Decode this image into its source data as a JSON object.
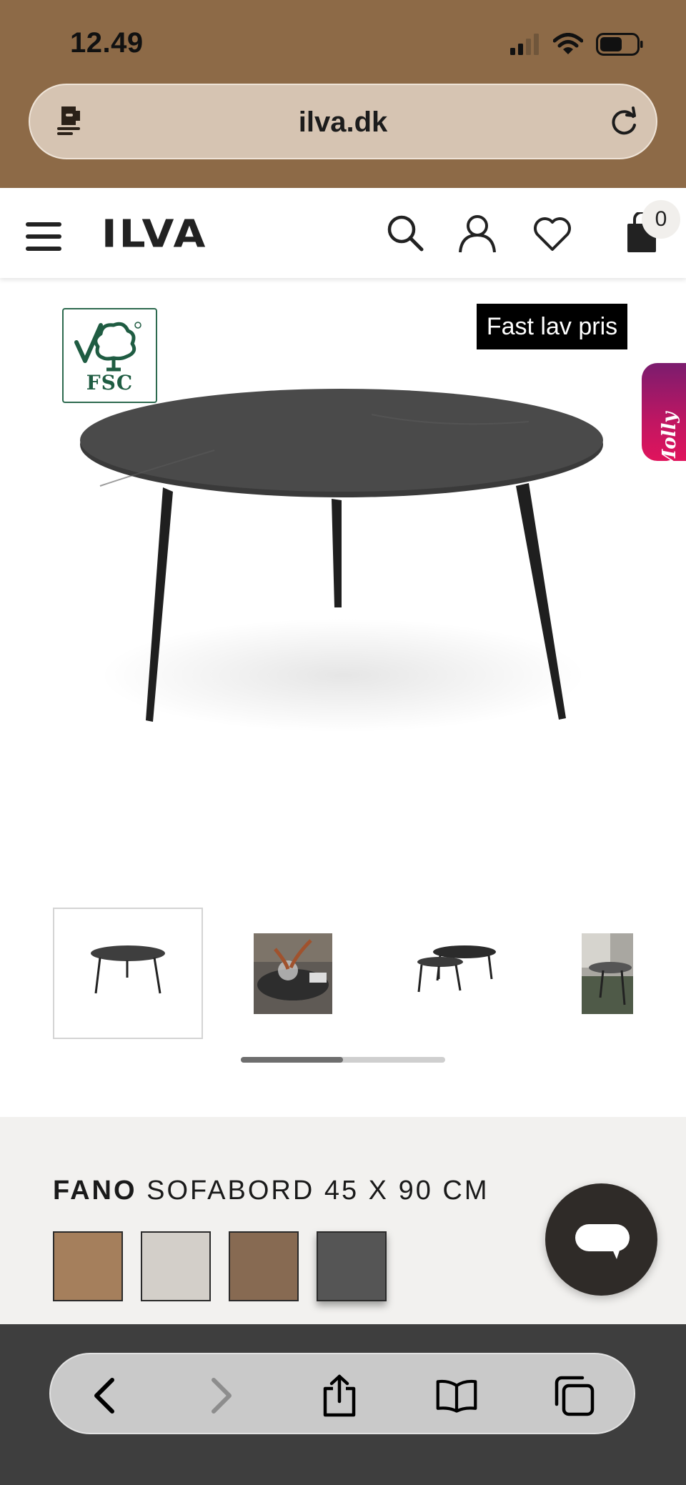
{
  "status_bar": {
    "time": "12.49"
  },
  "browser": {
    "url": "ilva.dk"
  },
  "site": {
    "logo": "ILVA",
    "cart_count": "0"
  },
  "product": {
    "fsc_label": "FSC",
    "price_tag": "Fast lav pris",
    "brand": "FANO",
    "name": "SOFABORD 45 X 90 CM",
    "swatches": [
      {
        "color": "#a57f5c",
        "selected": false
      },
      {
        "color": "#d3cfc9",
        "selected": false
      },
      {
        "color": "#876a52",
        "selected": false
      },
      {
        "color": "#555555",
        "selected": true
      }
    ]
  },
  "assistant_tab": {
    "label": "Molly"
  },
  "gallery": {
    "thumbnail_count": 4,
    "active_index": 0,
    "scroll_progress": 0.5
  },
  "colors": {
    "top_chrome": "#8d6a47",
    "url_bar": "#d6c4b2",
    "info_panel": "#f2f1ef",
    "bottom_chrome": "#3e3e3e",
    "accent_tab": "#c01662"
  }
}
